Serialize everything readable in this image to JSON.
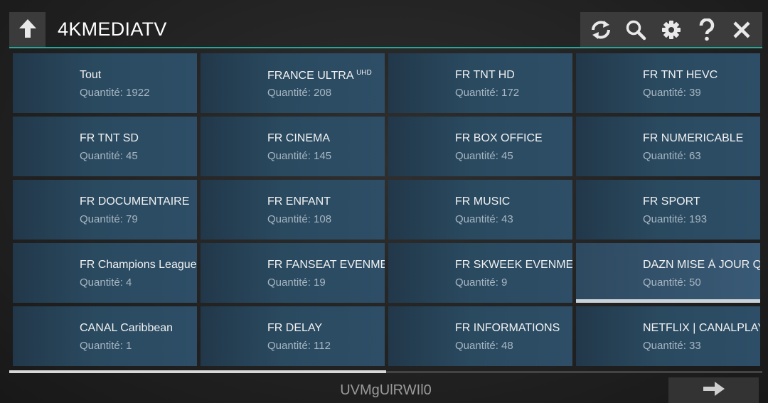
{
  "header": {
    "title": "4KMEDIATV",
    "accent_color": "#26a79a",
    "icons": [
      "back-arrow-icon",
      "refresh-icon",
      "search-icon",
      "gear-icon",
      "help-icon",
      "close-icon"
    ]
  },
  "categories": [
    {
      "name": "Tout",
      "count": "Quantité: 1922"
    },
    {
      "name": "FRANCE ULTRA",
      "sup": "UHD",
      "count": "Quantité: 208"
    },
    {
      "name": "FR TNT HD",
      "count": "Quantité: 172"
    },
    {
      "name": "FR TNT HEVC",
      "count": "Quantité: 39"
    },
    {
      "name": "FR TNT SD",
      "count": "Quantité: 45"
    },
    {
      "name": "FR CINEMA",
      "count": "Quantité: 145"
    },
    {
      "name": "FR BOX OFFICE",
      "count": "Quantité: 45"
    },
    {
      "name": "FR NUMERICABLE",
      "count": "Quantité: 63"
    },
    {
      "name": "FR DOCUMENTAIRE",
      "count": "Quantité: 79"
    },
    {
      "name": "FR ENFANT",
      "count": "Quantité: 108"
    },
    {
      "name": "FR MUSIC",
      "count": "Quantité: 43"
    },
    {
      "name": "FR SPORT",
      "count": "Quantité: 193"
    },
    {
      "name": "FR Champions League",
      "count": "Quantité: 4"
    },
    {
      "name": "FR FANSEAT EVENMENT",
      "count": "Quantité: 19"
    },
    {
      "name": "FR SKWEEK EVENMENT",
      "count": "Quantité: 9"
    },
    {
      "name": "DAZN MISE À JOUR QUOTIDIENNE",
      "count": "Quantité: 50",
      "selected": true
    },
    {
      "name": "CANAL Caribbean",
      "count": "Quantité: 1"
    },
    {
      "name": "FR DELAY",
      "count": "Quantité: 112"
    },
    {
      "name": "FR INFORMATIONS",
      "count": "Quantité: 48"
    },
    {
      "name": "NETFLIX | CANALPLAY",
      "count": "Quantité: 33"
    }
  ],
  "footer": {
    "code": "UVMgUlRWIl0",
    "scroll_fraction": 0.5
  }
}
